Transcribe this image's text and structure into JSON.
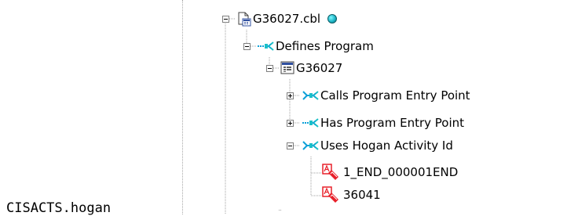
{
  "side_label": "CISACTS.hogan",
  "tree": {
    "nodes": [
      {
        "label": "G36027.cbl",
        "icon": "cobol-file-icon",
        "toggle": "expanded",
        "status_icon": "status-dot-icon"
      },
      {
        "label": "Defines Program",
        "icon": "relationship-arrow-icon",
        "toggle": "expanded"
      },
      {
        "label": "G36027",
        "icon": "program-icon",
        "toggle": "expanded"
      },
      {
        "label": "Calls Program Entry Point",
        "icon": "relationship-arrow-icon",
        "toggle": "collapsed"
      },
      {
        "label": "Has Program Entry Point",
        "icon": "relationship-arrow-icon",
        "toggle": "collapsed"
      },
      {
        "label": "Uses Hogan Activity Id",
        "icon": "relationship-arrow-icon",
        "toggle": "expanded"
      },
      {
        "label": "1_END_000001END",
        "icon": "hogan-activity-icon",
        "toggle": "none"
      },
      {
        "label": "36041",
        "icon": "hogan-activity-icon",
        "toggle": "none"
      }
    ]
  },
  "colors": {
    "connector": "#a0a0a0",
    "arrow_blue": "#0a9fd8",
    "arrow_teal": "#1ac0c8",
    "activity_red": "#e8202a",
    "status_dot": "#1fb7c8"
  }
}
